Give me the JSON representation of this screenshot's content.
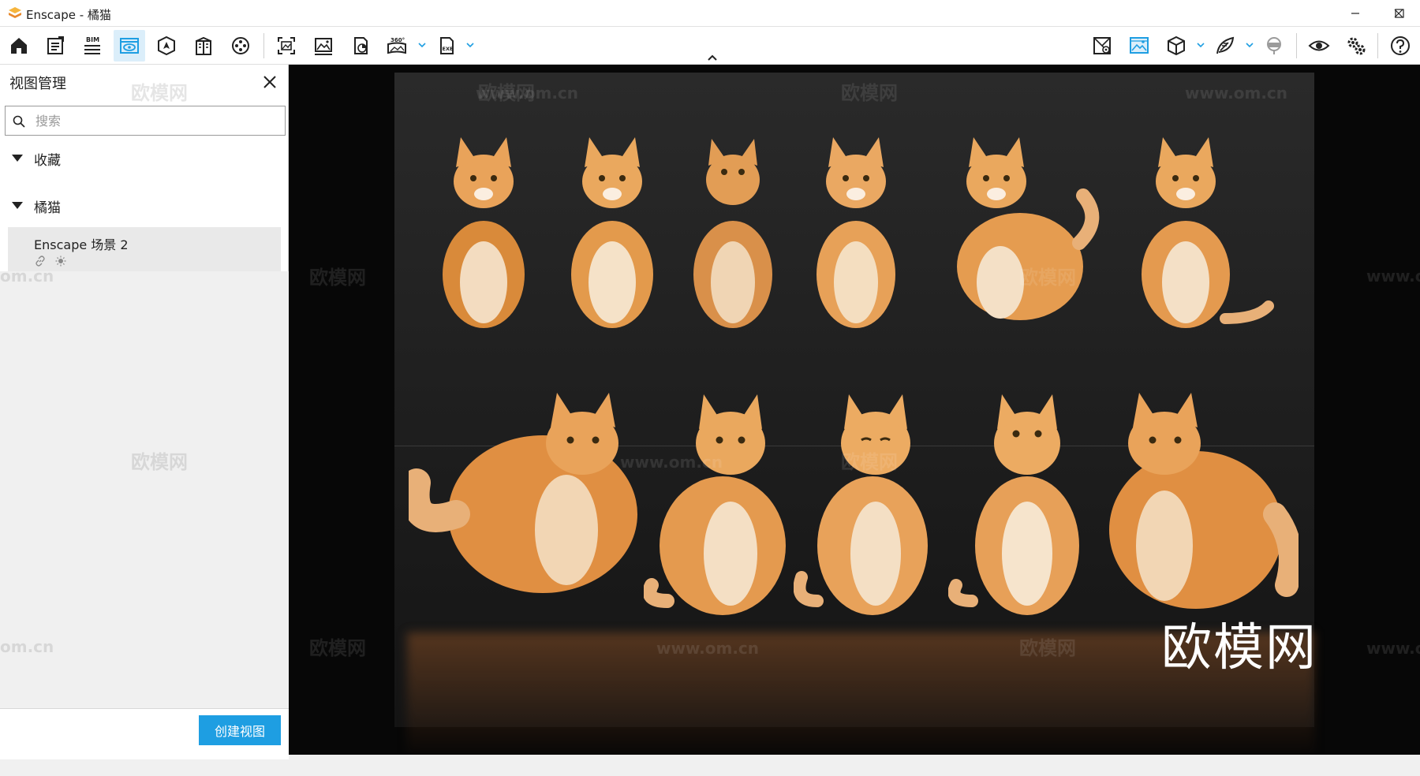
{
  "window": {
    "title": "Enscape - 橘猫",
    "controls": [
      "minimize",
      "maximize",
      "close"
    ]
  },
  "toolbar": {
    "left_icons": [
      "home-icon",
      "notes-icon",
      "bim-icon",
      "view-management-icon",
      "navigation-icon",
      "building-icon",
      "video-icon",
      "capture-icon",
      "screenshot-icon",
      "batch-render-icon",
      "panorama-360-icon",
      "export-exe-icon"
    ],
    "bim_label": "BIM",
    "pano_label": "360°",
    "exe_label": "EXE",
    "right_icons": [
      "site-context-icon",
      "visual-settings-icon",
      "cube-icon",
      "asset-library-icon",
      "vr-headset-icon",
      "eye-icon",
      "settings-icon",
      "help-icon"
    ],
    "active": "view-management-icon"
  },
  "sidebar": {
    "title": "视图管理",
    "search_placeholder": "搜索",
    "sections": [
      {
        "label": "收藏"
      },
      {
        "label": "橘猫"
      }
    ],
    "views": [
      {
        "name": "Enscape 场景 2"
      }
    ],
    "create_button": "创建视图"
  },
  "viewport": {
    "watermark_text": "欧模网",
    "watermark_url": "www.om.cn",
    "side_watermark_url": "om.cn"
  },
  "colors": {
    "accent": "#1e9ee2",
    "active_tab_bg": "#dbeefa",
    "brand_logo": "#f0a033"
  }
}
